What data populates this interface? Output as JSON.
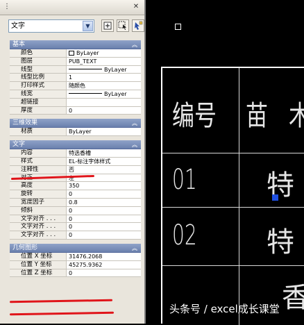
{
  "toolbar": {
    "selected_type": "文字",
    "icons": [
      "quick-select-icon",
      "select-objects-icon",
      "toggle-pickadd-icon"
    ]
  },
  "sections": [
    {
      "name": "基本",
      "rows": [
        {
          "key": "颜色",
          "value": "ByLayer",
          "icon": "color-swatch"
        },
        {
          "key": "图层",
          "value": "PUB_TEXT"
        },
        {
          "key": "线型",
          "value": "ByLayer",
          "icon": "linetype-sample"
        },
        {
          "key": "线型比例",
          "value": "1"
        },
        {
          "key": "打印样式",
          "value": "随颜色"
        },
        {
          "key": "线宽",
          "value": "ByLayer",
          "icon": "linetype-sample"
        },
        {
          "key": "超链接",
          "value": ""
        },
        {
          "key": "厚度",
          "value": "0"
        }
      ]
    },
    {
      "name": "三维效果",
      "rows": [
        {
          "key": "材质",
          "value": "ByLayer"
        }
      ]
    },
    {
      "name": "文字",
      "rows": [
        {
          "key": "内容",
          "value": "特选香槽"
        },
        {
          "key": "样式",
          "value": "EL-标注字体样式"
        },
        {
          "key": "注释性",
          "value": "否"
        },
        {
          "key": "对正",
          "value": "左"
        },
        {
          "key": "高度",
          "value": "350"
        },
        {
          "key": "旋转",
          "value": "0"
        },
        {
          "key": "宽度因子",
          "value": "0.8"
        },
        {
          "key": "倾斜",
          "value": "0"
        },
        {
          "key": "文字对齐 . . .",
          "value": "0"
        },
        {
          "key": "文字对齐 . . .",
          "value": "0"
        },
        {
          "key": "文字对齐 . . .",
          "value": "0"
        }
      ]
    },
    {
      "name": "几何图形",
      "rows": [
        {
          "key": "位置 X 坐标",
          "value": "31476.2068"
        },
        {
          "key": "位置 Y 坐标",
          "value": "45275.9362"
        },
        {
          "key": "位置 Z 坐标",
          "value": "0"
        }
      ]
    }
  ],
  "drawing": {
    "headers": [
      "编号",
      "苗",
      "木"
    ],
    "rows": [
      {
        "no": "01",
        "name": "特"
      },
      {
        "no": "02",
        "name": "特"
      },
      {
        "no": "",
        "name": "香"
      }
    ]
  },
  "watermark": "头条号 / excel成长课堂",
  "colors": {
    "section_header": "#7b8fbb",
    "highlight_underline": "#e0151a",
    "grip": "#1f4fe0"
  }
}
